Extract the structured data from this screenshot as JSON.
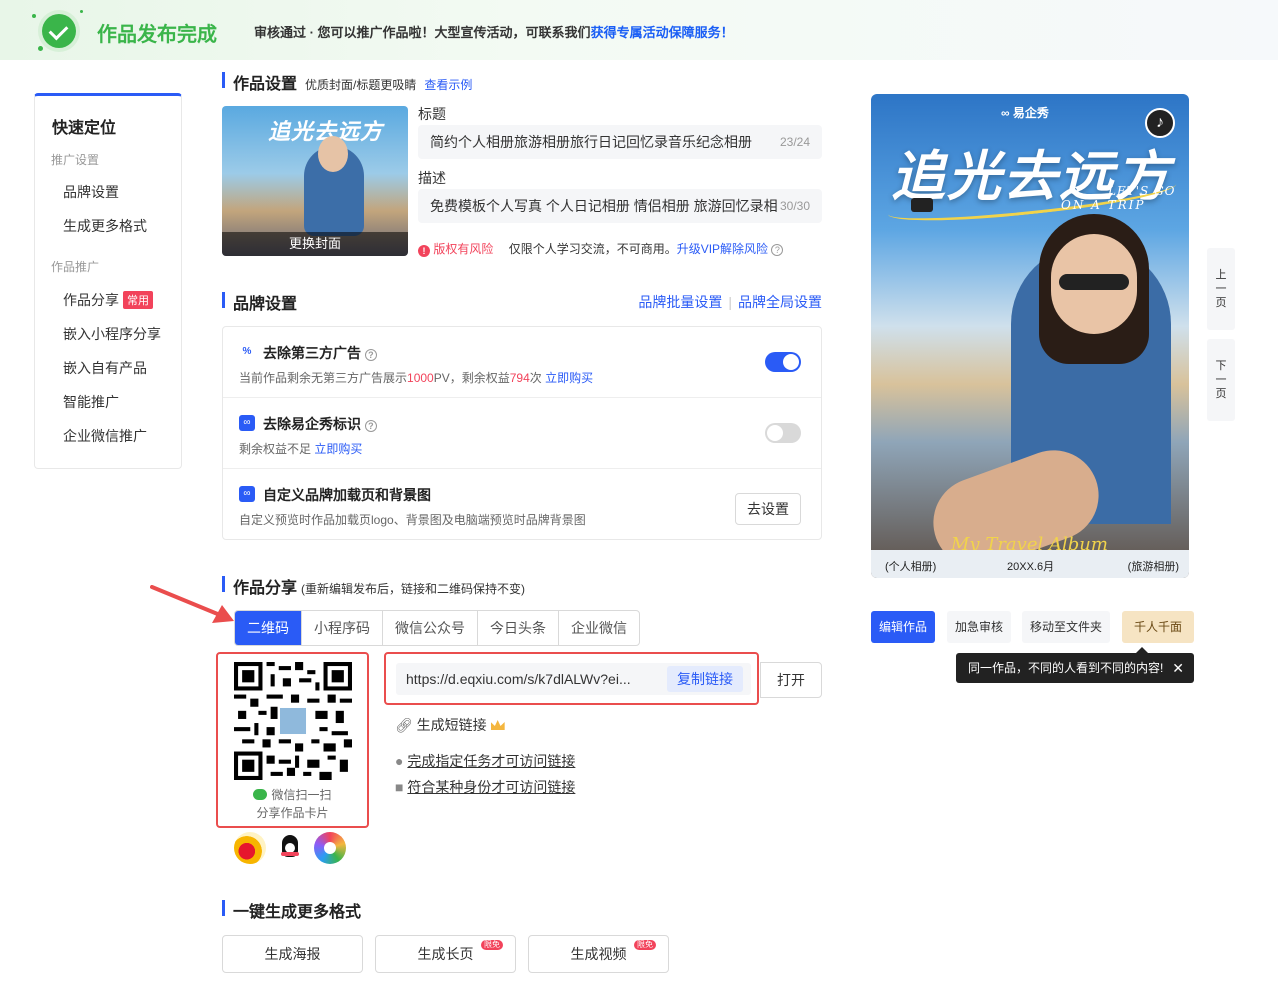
{
  "banner": {
    "title": "作品发布完成",
    "message": "审核通过 · 您可以推广作品啦！大型宣传活动，可联系我们",
    "message_link": "获得专属活动保障服务！"
  },
  "nav": {
    "heading": "快速定位",
    "group1": "推广设置",
    "group1_items": [
      "品牌设置",
      "生成更多格式"
    ],
    "group2": "作品推广",
    "group2_items": [
      "作品分享",
      "嵌入小程序分享",
      "嵌入自有产品",
      "智能推广",
      "企业微信推广"
    ],
    "share_tag": "常用"
  },
  "settings": {
    "title": "作品设置",
    "subtitle": "优质封面/标题更吸睛",
    "example_link": "查看示例",
    "change_cover": "更换封面",
    "cover_title": "追光去远方",
    "title_label": "标题",
    "title_value": "简约个人相册旅游相册旅行日记回忆录音乐纪念相册",
    "title_count": "23/24",
    "desc_label": "描述",
    "desc_value": "免费模板个人写真 个人日记相册 情侣相册 旅游回忆录相",
    "desc_count": "30/30",
    "risk_label": "版权有风险",
    "risk_text": "仅限个人学习交流，不可商用。",
    "risk_link": "升级VIP解除风险"
  },
  "brand": {
    "title": "品牌设置",
    "batch_link": "品牌批量设置",
    "global_link": "品牌全局设置",
    "rows": [
      {
        "title": "去除第三方广告",
        "desc_pre": "当前作品剩余无第三方广告展示",
        "desc_num1": "1000",
        "desc_mid": "PV，剩余权益",
        "desc_num2": "794",
        "desc_post": "次",
        "link": "立即购买"
      },
      {
        "title": "去除易企秀标识",
        "desc_pre": "剩余权益不足",
        "link": "立即购买"
      },
      {
        "title": "自定义品牌加载页和背景图",
        "desc_pre": "自定义预览时作品加载页logo、背景图及电脑端预览时品牌背景图",
        "button": "去设置"
      }
    ]
  },
  "share": {
    "title": "作品分享",
    "subtitle": "(重新编辑发布后，链接和二维码保持不变)",
    "tabs": [
      "二维码",
      "小程序码",
      "微信公众号",
      "今日头条",
      "企业微信"
    ],
    "qr_caption1": "微信扫一扫",
    "qr_caption2": "分享作品卡片",
    "url": "https://d.eqxiu.com/s/k7dlALWv?ei...",
    "copy_button": "复制链接",
    "open_button": "打开",
    "short_link": "生成短链接",
    "task_link": "完成指定任务才可访问链接",
    "identity_link": "符合某种身份才可访问链接"
  },
  "formats": {
    "title": "一键生成更多格式",
    "buttons": [
      "生成海报",
      "生成长页",
      "生成视频"
    ],
    "badge": "限免"
  },
  "preview": {
    "brand": "易企秀",
    "title": "追光去远方",
    "line1": "LET'S GO",
    "line2": "ON A TRIP",
    "signature": "My Travel Album",
    "footer_left": "(个人相册)",
    "footer_mid": "20XX.6月",
    "footer_right": "(旅游相册)"
  },
  "pager": {
    "prev": "上一页",
    "next": "下一页"
  },
  "actions": {
    "edit": "编辑作品",
    "urgent": "加急审核",
    "move": "移动至文件夹",
    "personal": "千人千面",
    "tooltip": "同一作品，不同的人看到不同的内容!"
  },
  "colors": {
    "accent": "#2a5bf6",
    "success": "#3ab54a",
    "danger": "#f2435b",
    "highlight": "#ea4d4d"
  }
}
